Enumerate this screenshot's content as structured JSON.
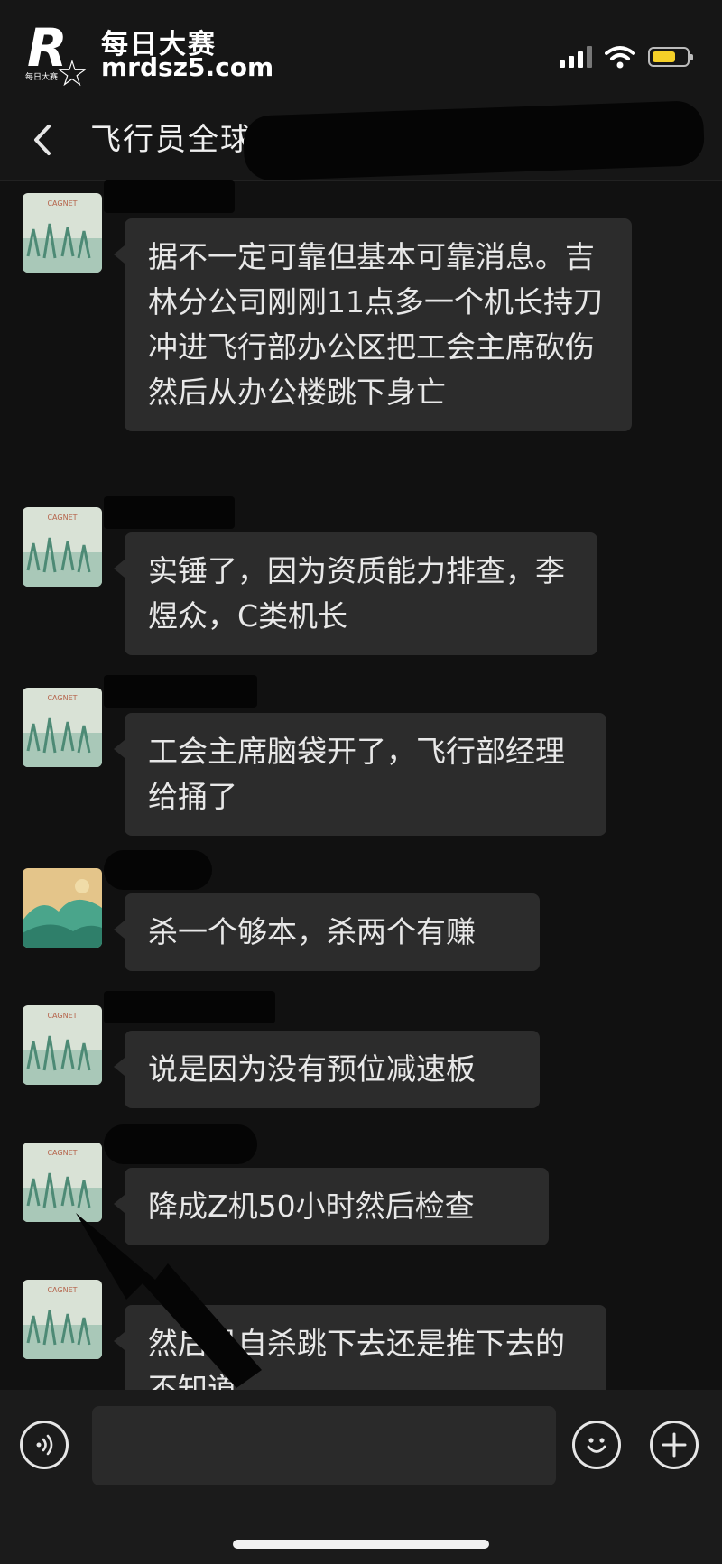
{
  "watermark": {
    "letter": "R",
    "sub": "每日大赛",
    "name": "每日大赛",
    "url": "mrdsz5.com"
  },
  "header": {
    "title": "飞行员全球"
  },
  "messages": [
    {
      "avatar": "cagnet",
      "text": "据不一定可靠但基本可靠消息。吉林分公司刚刚11点多一个机长持刀冲进飞行部办公区把工会主席砍伤然后从办公楼跳下身亡"
    },
    {
      "avatar": "cagnet",
      "text": "实锤了，因为资质能力排查，李煜众，C类机长"
    },
    {
      "avatar": "cagnet",
      "text": "工会主席脑袋开了，飞行部经理给捅了"
    },
    {
      "avatar": "landscape",
      "text": "杀一个够本，杀两个有赚"
    },
    {
      "avatar": "cagnet",
      "text": "说是因为没有预位减速板"
    },
    {
      "avatar": "cagnet",
      "text": "降成Z机50小时然后检查"
    },
    {
      "avatar": "cagnet",
      "text": "然后是自杀跳下去还是推下去的不知道"
    }
  ],
  "avatar_caption": "CAGNET",
  "input": {
    "value": "",
    "placeholder": ""
  },
  "colors": {
    "background": "#111111",
    "bubble": "#2c2c2c",
    "battery": "#f5d028"
  }
}
